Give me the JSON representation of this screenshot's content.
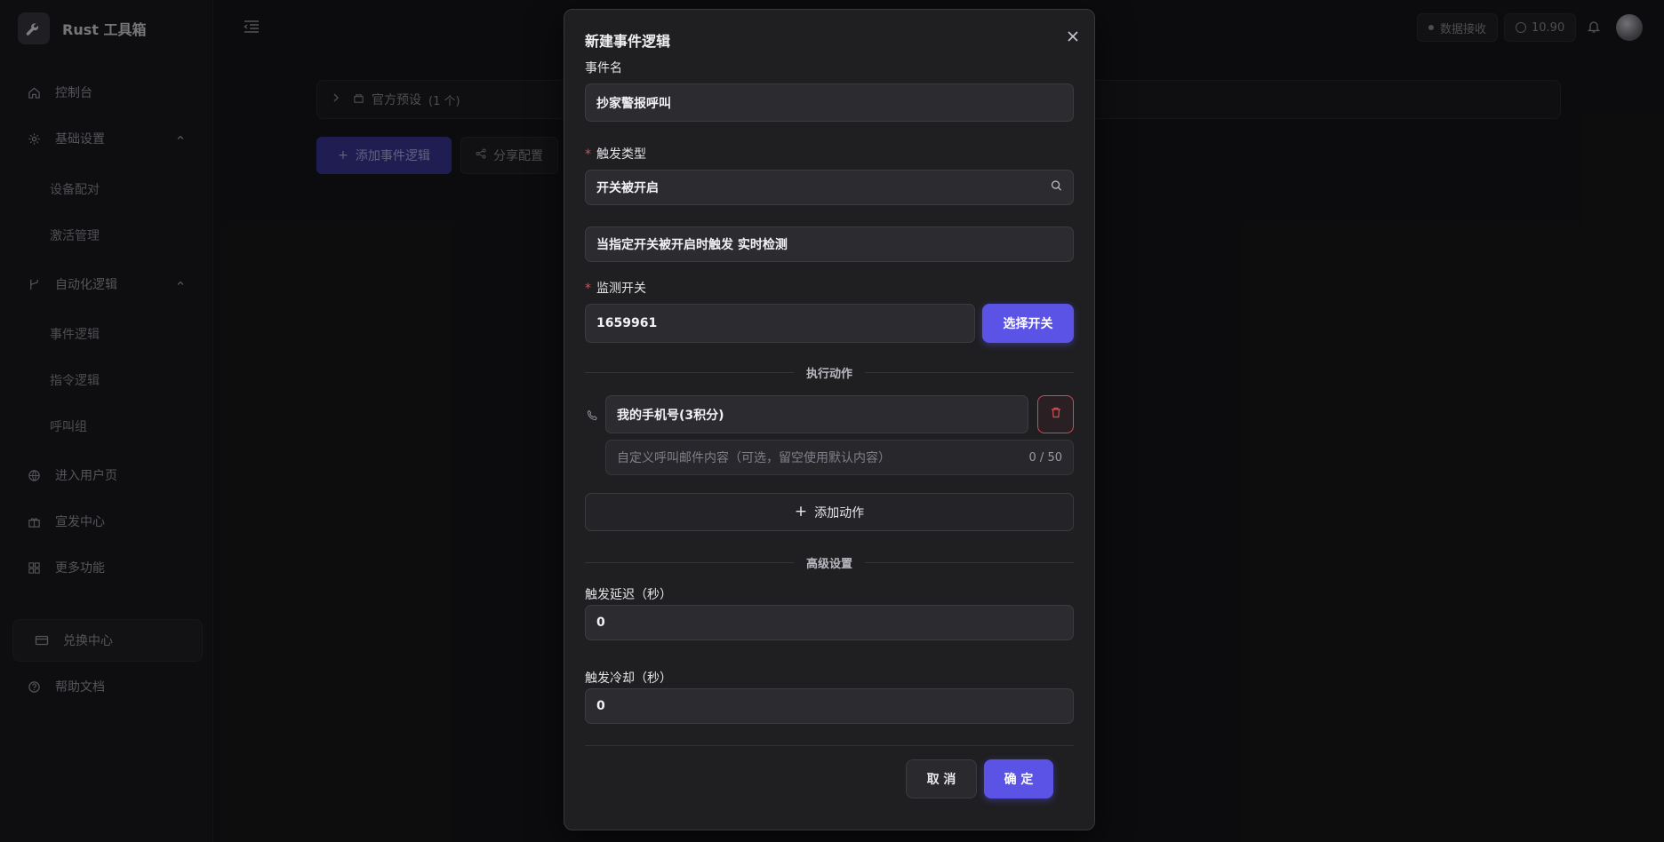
{
  "app": {
    "title": "Rust 工具箱"
  },
  "sidebar": {
    "items": [
      {
        "label": "控制台",
        "icon": "home-icon"
      },
      {
        "label": "基础设置",
        "icon": "gear-icon",
        "expanded": true,
        "children": [
          "设备配对",
          "激活管理"
        ]
      },
      {
        "label": "自动化逻辑",
        "icon": "branch-icon",
        "expanded": true,
        "children": [
          "事件逻辑",
          "指令逻辑",
          "呼叫组"
        ]
      },
      {
        "label": "进入用户页",
        "icon": "globe-icon"
      },
      {
        "label": "宣发中心",
        "icon": "gift-icon"
      },
      {
        "label": "更多功能",
        "icon": "grid-icon"
      }
    ],
    "redeem": {
      "label": "兑换中心",
      "icon": "card-icon"
    },
    "help": {
      "label": "帮助文档",
      "icon": "help-circle-icon"
    }
  },
  "topbar": {
    "status_label": "数据接收",
    "balance": "10.90"
  },
  "page": {
    "preset": {
      "label": "官方预设",
      "count": "(1 个)"
    },
    "add_button": "添加事件逻辑",
    "share_button": "分享配置"
  },
  "modal": {
    "title": "新建事件逻辑",
    "event_name": {
      "label": "事件名",
      "value": "抄家警报呼叫"
    },
    "trigger_type": {
      "label": "触发类型",
      "value": "开关被开启",
      "required": true
    },
    "trigger_desc": "当指定开关被开启时触发 实时检测",
    "monitor_switch": {
      "label": "监测开关",
      "value": "1659961",
      "required": true,
      "select_button": "选择开关"
    },
    "actions_divider": "执行动作",
    "action": {
      "value": "我的手机号(3积分)",
      "message_placeholder": "自定义呼叫邮件内容（可选，留空使用默认内容）",
      "counter": "0 / 50"
    },
    "add_action": "添加动作",
    "advanced_divider": "高级设置",
    "delay": {
      "label": "触发延迟（秒）",
      "value": "0"
    },
    "cooldown": {
      "label": "触发冷却（秒）",
      "value": "0"
    },
    "cancel": "取 消",
    "confirm": "确 定"
  },
  "colors": {
    "accent": "#5b53e6",
    "danger": "#e5484d",
    "modal_bg": "#1f1f22"
  }
}
